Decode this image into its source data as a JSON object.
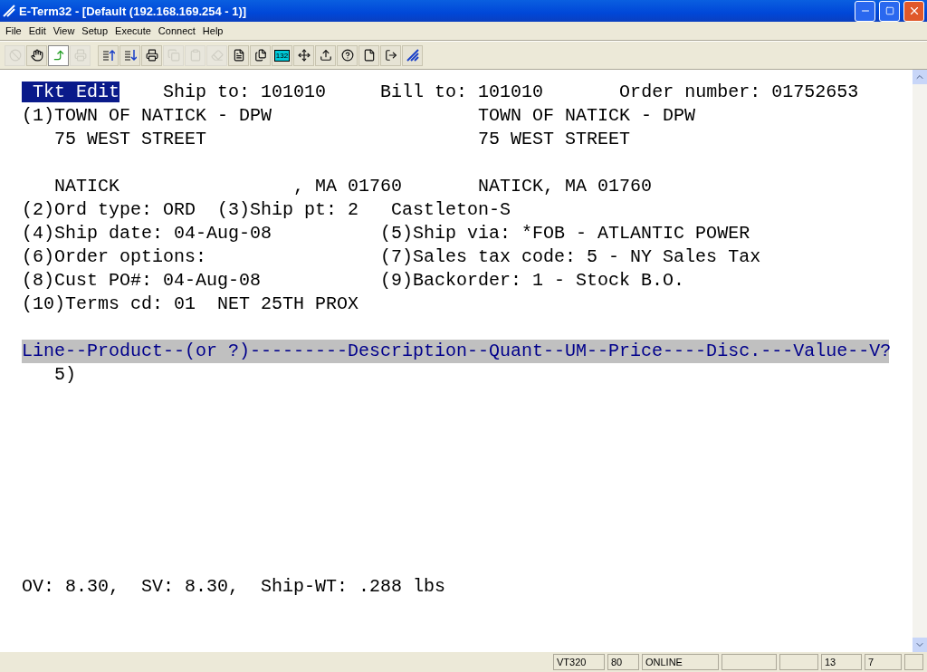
{
  "window": {
    "title": "E-Term32 - [Default (192.168.169.254 - 1)]"
  },
  "menu": [
    {
      "label": "File"
    },
    {
      "label": "Edit"
    },
    {
      "label": "View"
    },
    {
      "label": "Setup"
    },
    {
      "label": "Execute"
    },
    {
      "label": "Connect"
    },
    {
      "label": "Help"
    }
  ],
  "toolbar": [
    [
      {
        "kind": "stop",
        "disabled": true,
        "selected": false
      },
      {
        "kind": "hand",
        "disabled": false,
        "selected": false
      },
      {
        "kind": "arrow",
        "disabled": false,
        "selected": true
      },
      {
        "kind": "fax",
        "disabled": true,
        "selected": false
      }
    ],
    [
      {
        "kind": "up",
        "disabled": false,
        "selected": false
      },
      {
        "kind": "down",
        "disabled": false,
        "selected": false
      },
      {
        "kind": "print",
        "disabled": false,
        "selected": false
      },
      {
        "kind": "copy",
        "disabled": true,
        "selected": false
      },
      {
        "kind": "paste",
        "disabled": true,
        "selected": false
      },
      {
        "kind": "erase",
        "disabled": true,
        "selected": false
      },
      {
        "kind": "doc",
        "disabled": false,
        "selected": false
      },
      {
        "kind": "doc2",
        "disabled": false,
        "selected": false
      },
      {
        "kind": "cols",
        "label": "132",
        "disabled": false,
        "selected": false
      },
      {
        "kind": "move",
        "disabled": false,
        "selected": false
      },
      {
        "kind": "upload",
        "disabled": false,
        "selected": false
      },
      {
        "kind": "help",
        "disabled": false,
        "selected": false
      },
      {
        "kind": "file",
        "disabled": false,
        "selected": false
      },
      {
        "kind": "exit",
        "disabled": false,
        "selected": false
      },
      {
        "kind": "logo",
        "disabled": false,
        "selected": false
      }
    ]
  ],
  "screen": [
    {
      "kind": "badge",
      "badge": " Tkt Edit",
      "text": "    Ship to: 101010     Bill to: 101010       Order number: 01752653"
    },
    {
      "kind": "text",
      "text": "(1)TOWN OF NATICK - DPW                   TOWN OF NATICK - DPW"
    },
    {
      "kind": "text",
      "text": "   75 WEST STREET                         75 WEST STREET"
    },
    {
      "kind": "blank"
    },
    {
      "kind": "text",
      "text": "   NATICK                , MA 01760       NATICK, MA 01760"
    },
    {
      "kind": "text",
      "text": "(2)Ord type: ORD  (3)Ship pt: 2   Castleton-S"
    },
    {
      "kind": "text",
      "text": "(4)Ship date: 04-Aug-08          (5)Ship via: *FOB - ATLANTIC POWER"
    },
    {
      "kind": "text",
      "text": "(6)Order options:                (7)Sales tax code: 5 - NY Sales Tax"
    },
    {
      "kind": "text",
      "text": "(8)Cust PO#: 04-Aug-08           (9)Backorder: 1 - Stock B.O."
    },
    {
      "kind": "text",
      "text": "(10)Terms cd: 01  NET 25TH PROX"
    },
    {
      "kind": "blank"
    },
    {
      "kind": "header",
      "text": "Line--Product--(or ?)---------Description--Quant--UM--Price----Disc.---Value--V?"
    },
    {
      "kind": "text",
      "text": "   5)"
    },
    {
      "kind": "blank"
    },
    {
      "kind": "blank"
    },
    {
      "kind": "blank"
    },
    {
      "kind": "blank"
    },
    {
      "kind": "blank"
    },
    {
      "kind": "blank"
    },
    {
      "kind": "blank"
    },
    {
      "kind": "blank"
    },
    {
      "kind": "text",
      "text": "OV: 8.30,  SV: 8.30,  Ship-WT: .288 lbs"
    }
  ],
  "status_bar": [
    {
      "kind": "text",
      "text": "VT320"
    },
    {
      "kind": "text",
      "text": "80"
    },
    {
      "kind": "text",
      "text": "ONLINE"
    },
    {
      "kind": "empty"
    },
    {
      "kind": "empty"
    },
    {
      "kind": "text",
      "text": "13"
    },
    {
      "kind": "text",
      "text": "7"
    },
    {
      "kind": "empty"
    }
  ]
}
